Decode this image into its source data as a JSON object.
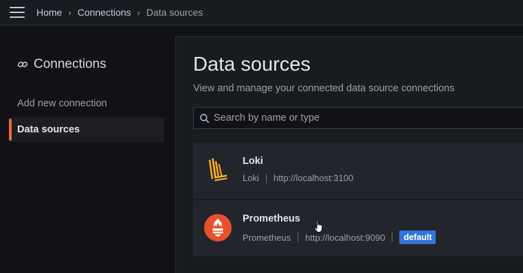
{
  "topbar": {
    "breadcrumbs": [
      "Home",
      "Connections",
      "Data sources"
    ]
  },
  "sidebar": {
    "title": "Connections",
    "items": [
      {
        "label": "Add new connection",
        "active": false
      },
      {
        "label": "Data sources",
        "active": true
      }
    ]
  },
  "main": {
    "title": "Data sources",
    "subtitle": "View and manage your connected data source connections",
    "search": {
      "placeholder": "Search by name or type",
      "value": ""
    },
    "datasources": [
      {
        "name": "Loki",
        "type": "Loki",
        "url": "http://localhost:3100",
        "default": false,
        "icon": "loki-logo-icon"
      },
      {
        "name": "Prometheus",
        "type": "Prometheus",
        "url": "http://localhost:9090",
        "default": true,
        "badge": "default",
        "icon": "prometheus-logo-icon"
      }
    ]
  },
  "colors": {
    "accent_active": "#f36b31",
    "badge": "#3274d9",
    "prometheus": "#e6522c",
    "loki": "#f5a623"
  }
}
